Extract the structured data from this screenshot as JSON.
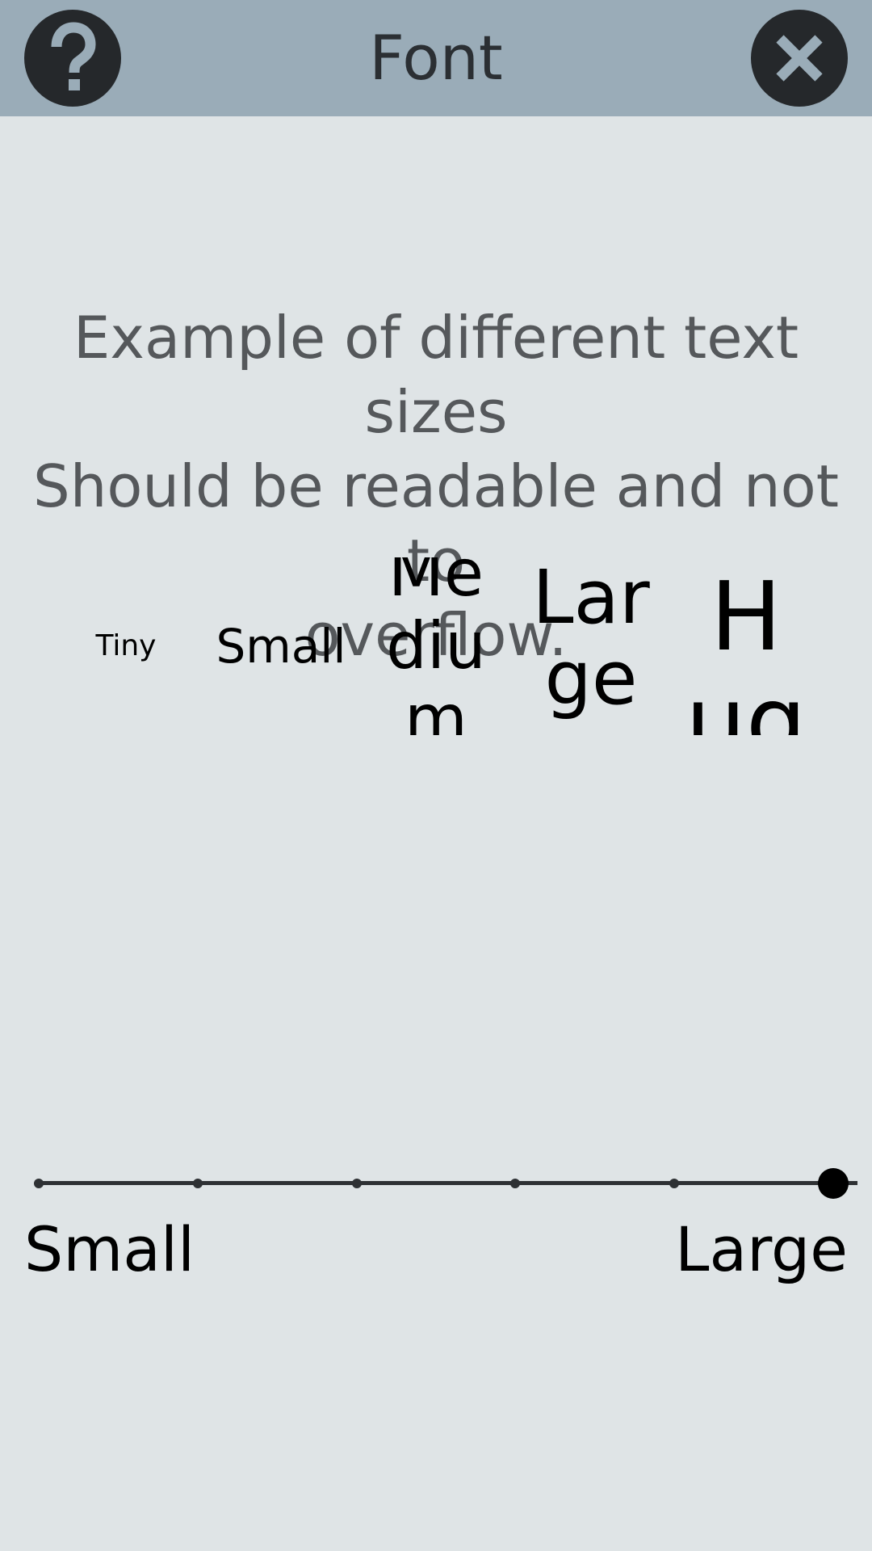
{
  "header": {
    "title": "Font",
    "help_icon": "question-mark-icon",
    "close_icon": "close-x-icon"
  },
  "example": {
    "text": "Example of different text sizes\nShould be readable and not to\noverflow."
  },
  "samples": {
    "tiny": "Tiny",
    "small": "Small",
    "medium": "Medium",
    "large": "Large",
    "huge": "Huge"
  },
  "slider": {
    "min_label": "Small",
    "max_label": "Large",
    "steps": 6,
    "selected_step": 6
  },
  "colors": {
    "header_bg": "#9aacb8",
    "page_bg": "#dfe4e6",
    "button_bg": "#25282b",
    "icon_color": "#9aacb8"
  }
}
